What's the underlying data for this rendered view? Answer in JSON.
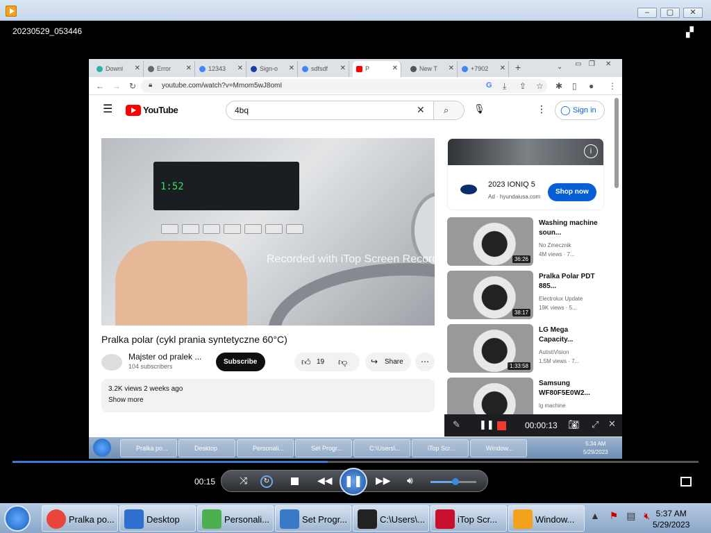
{
  "window": {
    "title": "20230529_053446"
  },
  "browser": {
    "tabs": [
      {
        "label": "Downl",
        "color": "#2bb5a0"
      },
      {
        "label": "Error",
        "color": "#666666"
      },
      {
        "label": "12343",
        "color": "#4285f4"
      },
      {
        "label": "Sign-o",
        "color": "#1a3fa6"
      },
      {
        "label": "sdfsdf",
        "color": "#4285f4"
      },
      {
        "label": "P",
        "color": "#ff0000"
      },
      {
        "label": "New T",
        "color": "#555555"
      },
      {
        "label": "+7902",
        "color": "#4285f4"
      }
    ],
    "url": "youtube.com/watch?v=Mmom5wJ8omI"
  },
  "youtube": {
    "logo_text": "YouTube",
    "search_value": "4bq",
    "signin": "Sign in",
    "video_title": "Pralka polar (cykl prania syntetyczne 60°C)",
    "panel_display": "1:52",
    "watermark": "Recorded with iTop Screen Recorder",
    "channel_name": "Majster od pralek ...",
    "channel_subs": "104 subscribers",
    "subscribe": "Subscribe",
    "likes": "19",
    "share": "Share",
    "views_line": "3.2K views  2 weeks ago",
    "show_more": "Show more",
    "ad": {
      "title": "2023 IONIQ 5",
      "sub": "Ad · hyundaiusa.com",
      "cta": "Shop now"
    },
    "recommendations": [
      {
        "title": "Washing machine soun...",
        "channel": "No Zmecznik",
        "views": "4M views · 7...",
        "duration": "36:26"
      },
      {
        "title": "Pralka Polar PDT 885...",
        "channel": "Electrolux Update",
        "views": "19K views · 5...",
        "duration": "38:17"
      },
      {
        "title": "LG Mega Capacity...",
        "channel": "AutistiVision",
        "views": "1.5M views · 7...",
        "duration": "1:33:58"
      },
      {
        "title": "Samsung WF80F5E0W2...",
        "channel": "lg machine",
        "views": "",
        "duration": ""
      }
    ]
  },
  "recorder": {
    "time": "00:00:13"
  },
  "inner_taskbar": {
    "items": [
      "Pralka po...",
      "Desktop",
      "Personali...",
      "Set Progr...",
      "C:\\Users\\...",
      "iTop Scr...",
      "Window..."
    ],
    "time": "5:34 AM",
    "date": "5/29/2023"
  },
  "player": {
    "time": "00:15",
    "progress": 0.46,
    "volume": 0.55
  },
  "taskbar": {
    "items": [
      {
        "label": "Pralka po...",
        "color": "#e8453c"
      },
      {
        "label": "Desktop",
        "color": "#2f6fd0"
      },
      {
        "label": "Personali...",
        "color": "#4caf50"
      },
      {
        "label": "Set Progr...",
        "color": "#3a78c8"
      },
      {
        "label": "C:\\Users\\...",
        "color": "#222222"
      },
      {
        "label": "iTop Scr...",
        "color": "#c8102e"
      },
      {
        "label": "Window...",
        "color": "#f3a21c"
      }
    ],
    "time": "5:37 AM",
    "date": "5/29/2023"
  }
}
